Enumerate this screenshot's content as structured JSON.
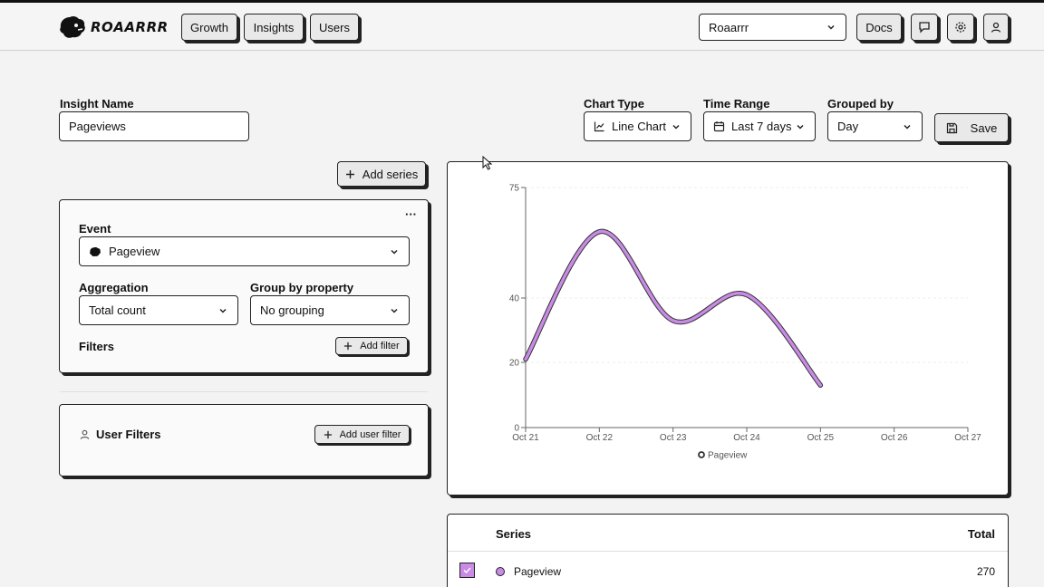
{
  "nav": {
    "brand": "ROAARRR",
    "tabs": [
      "Growth",
      "Insights",
      "Users"
    ],
    "project": "Roaarrr",
    "docs": "Docs"
  },
  "form": {
    "insight_name_label": "Insight Name",
    "insight_name_value": "Pageviews",
    "chart_type_label": "Chart Type",
    "chart_type_value": "Line Chart",
    "time_range_label": "Time Range",
    "time_range_value": "Last 7 days",
    "grouped_by_label": "Grouped by",
    "grouped_by_value": "Day",
    "save": "Save"
  },
  "series_panel": {
    "add_series": "Add series",
    "more": "···",
    "event_label": "Event",
    "event_value": "Pageview",
    "aggregation_label": "Aggregation",
    "aggregation_value": "Total count",
    "group_by_label": "Group by property",
    "group_by_value": "No grouping",
    "filters_label": "Filters",
    "add_filter": "Add filter"
  },
  "user_filters": {
    "title": "User Filters",
    "add": "Add user filter"
  },
  "chart_data": {
    "type": "line",
    "x": [
      "Oct 21",
      "Oct 22",
      "Oct 23",
      "Oct 24",
      "Oct 25",
      "Oct 26",
      "Oct 27"
    ],
    "y_ticks": [
      0,
      20,
      40,
      75
    ],
    "series": [
      {
        "name": "Pageview",
        "x": [
          "Oct 21",
          "Oct 22",
          "Oct 23",
          "Oct 24",
          "Oct 25"
        ],
        "values": [
          21,
          61,
          33,
          41,
          13
        ],
        "color": "#c98be6"
      }
    ],
    "legend_position": "bottom"
  },
  "table": {
    "col_series": "Series",
    "col_total": "Total",
    "rows": [
      {
        "name": "Pageview",
        "total": "270",
        "color": "#c98be6"
      }
    ]
  }
}
